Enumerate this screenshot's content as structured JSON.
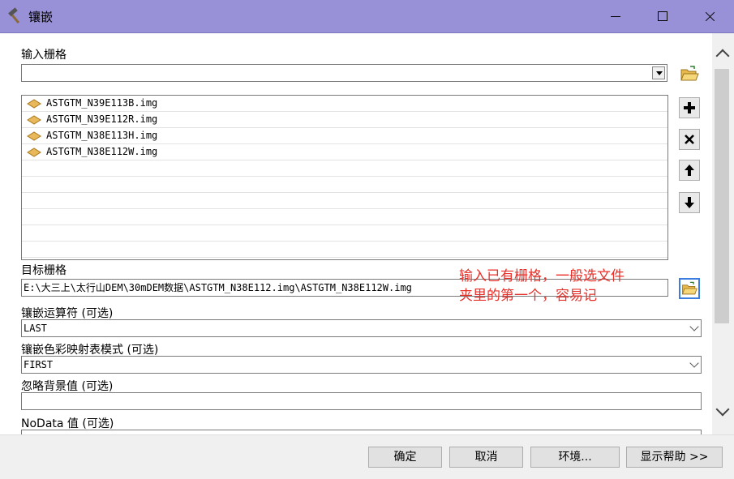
{
  "window": {
    "title": "镶嵌"
  },
  "input_rasters": {
    "label": "输入栅格",
    "value": "",
    "items": [
      "ASTGTM_N39E113B.img",
      "ASTGTM_N39E112R.img",
      "ASTGTM_N38E113H.img",
      "ASTGTM_N38E112W.img"
    ],
    "empty_rows": 6
  },
  "target_raster": {
    "label": "目标栅格",
    "value": "E:\\大三上\\太行山DEM\\30mDEM数据\\ASTGTM_N38E112.img\\ASTGTM_N38E112W.img"
  },
  "annotation": {
    "line1": "输入已有栅格，一般选文件",
    "line2": "夹里的第一个，容易记",
    "color": "#e8302a"
  },
  "mosaic_operator": {
    "label": "镶嵌运算符 (可选)",
    "value": "LAST"
  },
  "colormap_mode": {
    "label": "镶嵌色彩映射表模式 (可选)",
    "value": "FIRST"
  },
  "ignore_background": {
    "label": "忽略背景值 (可选)",
    "value": ""
  },
  "nodata": {
    "label": "NoData 值 (可选)",
    "value": ""
  },
  "buttons": {
    "ok": "确定",
    "cancel": "取消",
    "environments": "环境...",
    "show_help": "显示帮助 >>"
  },
  "icons": {
    "window": "hammer-icon",
    "browse": "open-folder-icon",
    "add": "plus-icon",
    "remove": "x-icon",
    "up": "arrow-up-icon",
    "down": "arrow-down-icon",
    "raster": "raster-dataset-icon"
  },
  "colors": {
    "titlebar": "#9891d8",
    "focus_border": "#3b7ee0"
  }
}
